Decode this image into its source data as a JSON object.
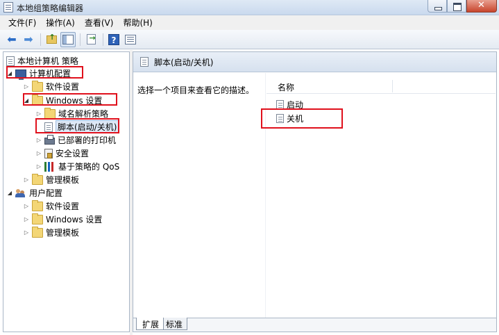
{
  "window": {
    "title": "本地组策略编辑器"
  },
  "menubar": {
    "items": [
      "文件(F)",
      "操作(A)",
      "查看(V)",
      "帮助(H)"
    ]
  },
  "toolbar": {
    "buttons": [
      "back-arrow-icon",
      "forward-arrow-icon",
      "folder-up-icon",
      "show-hide-tree-icon",
      "export-list-icon",
      "help-icon",
      "properties-icon"
    ]
  },
  "tree": {
    "root": "本地计算机 策略",
    "computer_config": "计算机配置",
    "software_settings": "软件设置",
    "windows_settings": "Windows 设置",
    "dns_policy": "域名解析策略",
    "scripts": "脚本(启动/关机)",
    "deployed_printers": "已部署的打印机",
    "security_settings": "安全设置",
    "qos": "基于策略的 QoS",
    "admin_templates": "管理模板",
    "user_config": "用户配置",
    "user_software_settings": "软件设置",
    "user_windows_settings": "Windows 设置",
    "user_admin_templates": "管理模板"
  },
  "right_pane": {
    "header": "脚本(启动/关机)",
    "description": "选择一个项目来查看它的描述。",
    "column_name": "名称",
    "items": [
      "启动",
      "关机"
    ]
  },
  "tabs": {
    "extended": "扩展",
    "standard": "标准"
  },
  "colors": {
    "highlight_box": "#e0101c",
    "selection": "#dde8f6"
  }
}
